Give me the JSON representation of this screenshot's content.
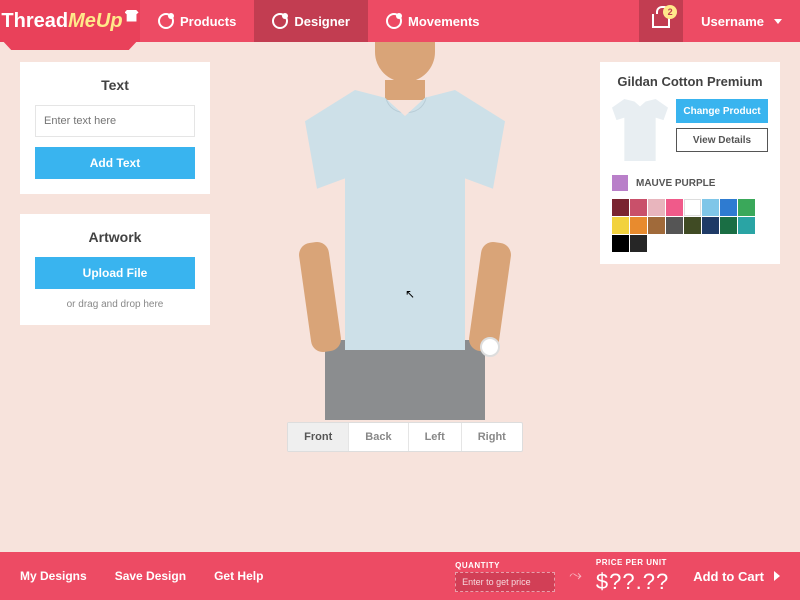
{
  "brand": {
    "part1": "Thread",
    "part2": "MeUp"
  },
  "nav": {
    "items": [
      {
        "label": "Products",
        "active": false
      },
      {
        "label": "Designer",
        "active": true
      },
      {
        "label": "Movements",
        "active": false
      }
    ],
    "cart_count": "2",
    "username": "Username"
  },
  "text_panel": {
    "title": "Text",
    "placeholder": "Enter text here",
    "button": "Add Text"
  },
  "artwork_panel": {
    "title": "Artwork",
    "button": "Upload File",
    "hint": "or drag and drop here"
  },
  "views": {
    "items": [
      "Front",
      "Back",
      "Left",
      "Right"
    ],
    "active": "Front"
  },
  "product": {
    "name": "Gildan Cotton Premium",
    "change_btn": "Change Product",
    "details_btn": "View Details",
    "selected_color_name": "MAUVE PURPLE",
    "selected_color_hex": "#b97fc9",
    "swatches": [
      "#7a2430",
      "#c9506a",
      "#e8b5bd",
      "#f05a8a",
      "#ffffff",
      "#7fc6e8",
      "#2e7bd1",
      "#3aa85a",
      "#f2d23e",
      "#e88b2e",
      "#a06a3a",
      "#555555",
      "#404b24",
      "#1e3a66",
      "#1a6e44",
      "#2aa4a4",
      "#000000",
      "#262626"
    ]
  },
  "bottom": {
    "links": [
      "My Designs",
      "Save Design",
      "Get Help"
    ],
    "qty_label": "QUANTITY",
    "qty_placeholder": "Enter to get price",
    "ppu_label": "PRICE PER UNIT",
    "price": "$??.??",
    "add_to_cart": "Add to Cart"
  }
}
